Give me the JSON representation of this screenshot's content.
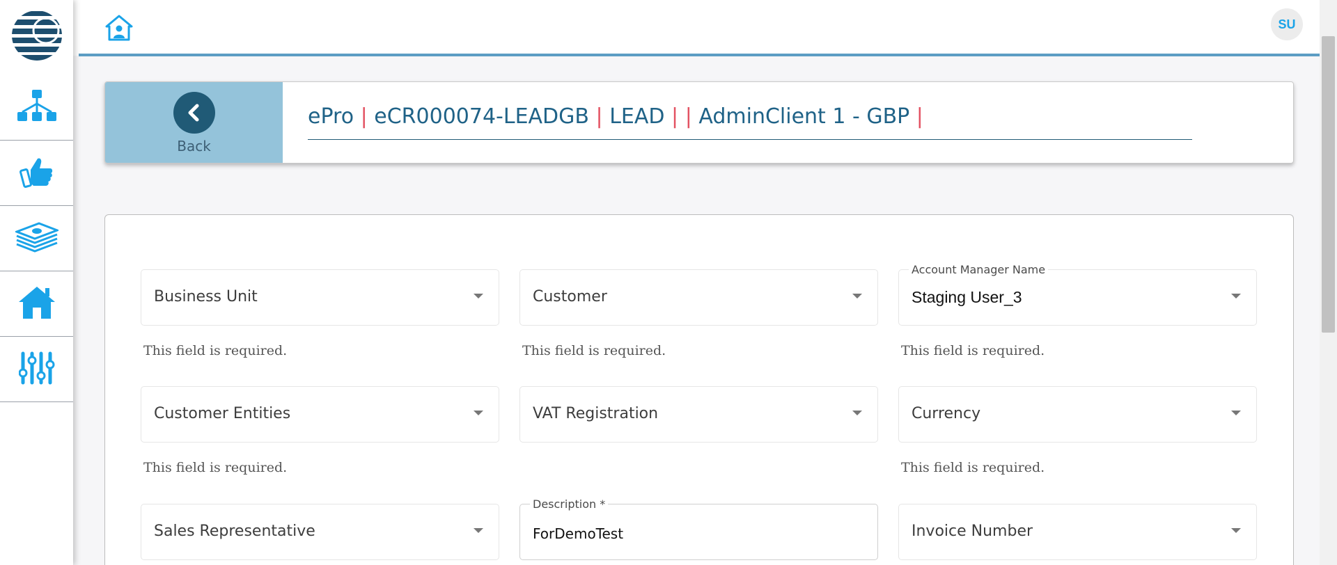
{
  "topbar": {
    "avatar_initials": "SU"
  },
  "sidebar": {
    "items": [
      {
        "icon": "org-chart-icon"
      },
      {
        "icon": "thumbs-up-icon"
      },
      {
        "icon": "money-stack-icon"
      },
      {
        "icon": "home-icon"
      },
      {
        "icon": "sliders-icon"
      }
    ]
  },
  "header": {
    "back_label": "Back",
    "crumbs": [
      "ePro",
      "eCR000074-LEADGB",
      "LEAD",
      "",
      "AdminClient 1 - GBP"
    ],
    "separator": "|"
  },
  "form": {
    "fields": [
      {
        "label": "",
        "value": "Business Unit",
        "helper": "This field is required."
      },
      {
        "label": "",
        "value": "Customer",
        "helper": "This field is required."
      },
      {
        "label": "Account Manager Name",
        "value": "Staging User_3",
        "helper": "This field is required."
      },
      {
        "label": "",
        "value": "Customer Entities",
        "helper": "This field is required."
      },
      {
        "label": "",
        "value": "VAT Registration",
        "helper": ""
      },
      {
        "label": "",
        "value": "Currency",
        "helper": "This field is required."
      },
      {
        "label": "",
        "value": "Sales Representative",
        "helper": ""
      },
      {
        "label": "Description *",
        "value": "ForDemoTest",
        "helper": ""
      },
      {
        "label": "",
        "value": "Invoice Number",
        "helper": ""
      }
    ]
  },
  "colors": {
    "accent": "#5c9dc4",
    "brand_dark": "#205a76",
    "icon_blue": "#1aa3e8",
    "separator_red": "#e35262",
    "back_panel": "#94c3da"
  }
}
